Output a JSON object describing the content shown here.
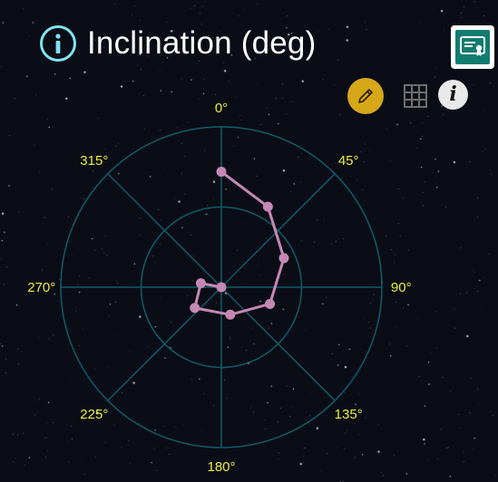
{
  "header": {
    "title": "Inclination (deg)"
  },
  "toolbar": {
    "icons": [
      "info-circle-icon",
      "certificate-icon",
      "pencil-icon",
      "grid-icon",
      "info-icon"
    ]
  },
  "colors": {
    "background": "#0b0d16",
    "grid": "#0f5c68",
    "tick_labels": "#ecec3e",
    "series": "#c587b4",
    "title": "#ffffff",
    "info_icon": "#7fe3f0",
    "cert_button": "#127c70",
    "pencil_button": "#d5a719"
  },
  "chart_data": {
    "type": "polar-line",
    "title": "Inclination (deg)",
    "angle_labels": [
      "0°",
      "45°",
      "90°",
      "135°",
      "180°",
      "225°",
      "270°",
      "315°"
    ],
    "angle_direction": "clockwise",
    "angle_zero": "top",
    "radial_rings": 2,
    "radial_range": [
      0,
      1
    ],
    "grid": true,
    "series": [
      {
        "points": [
          {
            "theta": 0,
            "r": 0.72
          },
          {
            "theta": 30,
            "r": 0.58
          },
          {
            "theta": 65,
            "r": 0.43
          },
          {
            "theta": 109,
            "r": 0.32
          },
          {
            "theta": 162,
            "r": 0.18
          },
          {
            "theta": 232,
            "r": 0.21
          },
          {
            "theta": 281,
            "r": 0.13
          },
          {
            "theta": 0,
            "r": 0.0
          }
        ]
      }
    ]
  }
}
